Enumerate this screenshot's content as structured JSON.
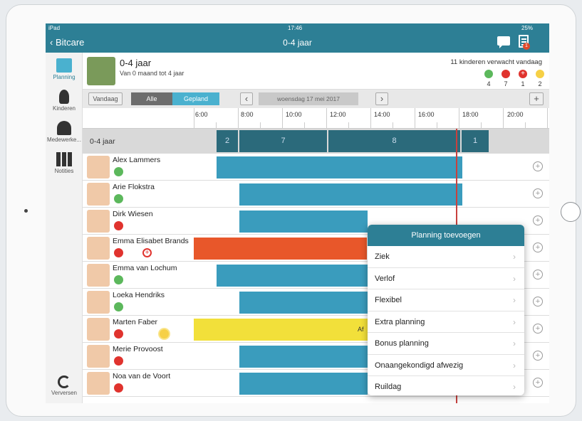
{
  "status": {
    "left": "iPad",
    "time": "17:46",
    "battery": "25%"
  },
  "nav": {
    "back": "Bitcare",
    "title": "0-4 jaar"
  },
  "sidebar": {
    "items": [
      {
        "label": "Planning"
      },
      {
        "label": "Kinderen"
      },
      {
        "label": "Medewerke..."
      },
      {
        "label": "Notities"
      },
      {
        "label": "Verversen"
      }
    ]
  },
  "group": {
    "name": "0-4 jaar",
    "sub": "Van 0 maand tot 4 jaar",
    "expected": "11 kinderen verwacht vandaag",
    "counts": [
      "4",
      "7",
      "1",
      "2"
    ]
  },
  "toolbar": {
    "today": "Vandaag",
    "all": "Alle",
    "planned": "Gepland",
    "date": "woensdag 17 mei 2017",
    "prev": "‹",
    "next": "›",
    "add": "+"
  },
  "times": [
    "6:00",
    "8:00",
    "10:00",
    "12:00",
    "14:00",
    "16:00",
    "18:00",
    "20:00"
  ],
  "header_row": {
    "label": "0-4 jaar",
    "segments": [
      "2",
      "7",
      "8",
      "1"
    ]
  },
  "children": [
    {
      "name": "Alex Lammers",
      "status": "green"
    },
    {
      "name": "Arie Flokstra",
      "status": "green"
    },
    {
      "name": "Dirk Wiesen",
      "status": "red"
    },
    {
      "name": "Emma Elisabet Brands",
      "status": "red"
    },
    {
      "name": "Emma van Lochum",
      "status": "green"
    },
    {
      "name": "Loeka Hendriks",
      "status": "green"
    },
    {
      "name": "Marten Faber",
      "status": "red"
    },
    {
      "name": "Merie Provoost",
      "status": "red"
    },
    {
      "name": "Noa van de Voort",
      "status": "red"
    }
  ],
  "yellow_bar_text": "Af",
  "popover": {
    "title": "Planning toevoegen",
    "items": [
      "Ziek",
      "Verlof",
      "Flexibel",
      "Extra planning",
      "Bonus planning",
      "Onaangekondigd afwezig",
      "Ruildag"
    ]
  },
  "colors": {
    "header": "#2d7f95",
    "bar": "#3a9cbd",
    "green": "#5cb85c",
    "red": "#e0332e",
    "orange": "#e8572a",
    "yellow": "#f2e03a"
  }
}
